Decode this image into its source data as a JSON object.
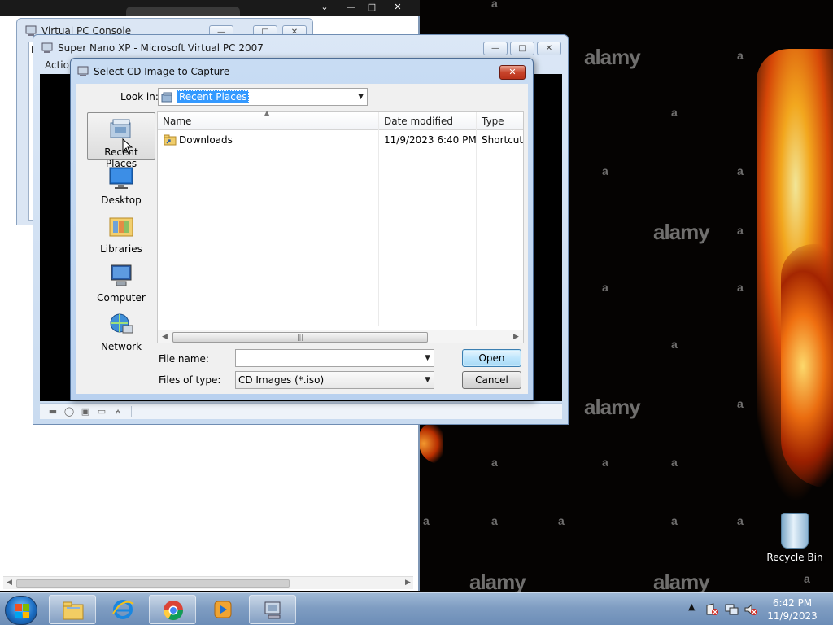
{
  "desktop": {
    "watermarks": [
      "alamy",
      "alamy",
      "alamy",
      "alamy",
      "alamy",
      "alamy",
      "a"
    ],
    "recycle_bin_label": "Recycle Bin"
  },
  "console_window": {
    "title": "Virtual PC Console",
    "menu_fragment": "F"
  },
  "vpc_window": {
    "title": "Super Nano XP - Microsoft Virtual PC 2007",
    "menu_fragment": "Actio"
  },
  "dialog": {
    "title": "Select CD Image to Capture",
    "look_in_label": "Look in:",
    "look_in_value": "Recent Places",
    "places": [
      {
        "label": "Recent Places",
        "icon": "recent-places-icon"
      },
      {
        "label": "Desktop",
        "icon": "desktop-icon"
      },
      {
        "label": "Libraries",
        "icon": "libraries-icon"
      },
      {
        "label": "Computer",
        "icon": "computer-icon"
      },
      {
        "label": "Network",
        "icon": "network-icon"
      }
    ],
    "columns": [
      "Name",
      "Date modified",
      "Type"
    ],
    "rows": [
      {
        "name": "Downloads",
        "date_modified": "11/9/2023 6:40 PM",
        "type": "Shortcut"
      }
    ],
    "file_name_label": "File name:",
    "file_name_value": "",
    "files_of_type_label": "Files of type:",
    "files_of_type_value": "CD Images (*.iso)",
    "open_label": "Open",
    "cancel_label": "Cancel"
  },
  "taskbar": {
    "pinned": [
      "explorer-icon",
      "internet-explorer-icon",
      "chrome-icon",
      "media-player-icon",
      "virtual-pc-icon"
    ],
    "clock_time": "6:42 PM",
    "clock_date": "11/9/2023"
  },
  "colors": {
    "selection": "#3399ff",
    "close_button": "#c8442b",
    "taskbar": "#7f9dc2"
  }
}
